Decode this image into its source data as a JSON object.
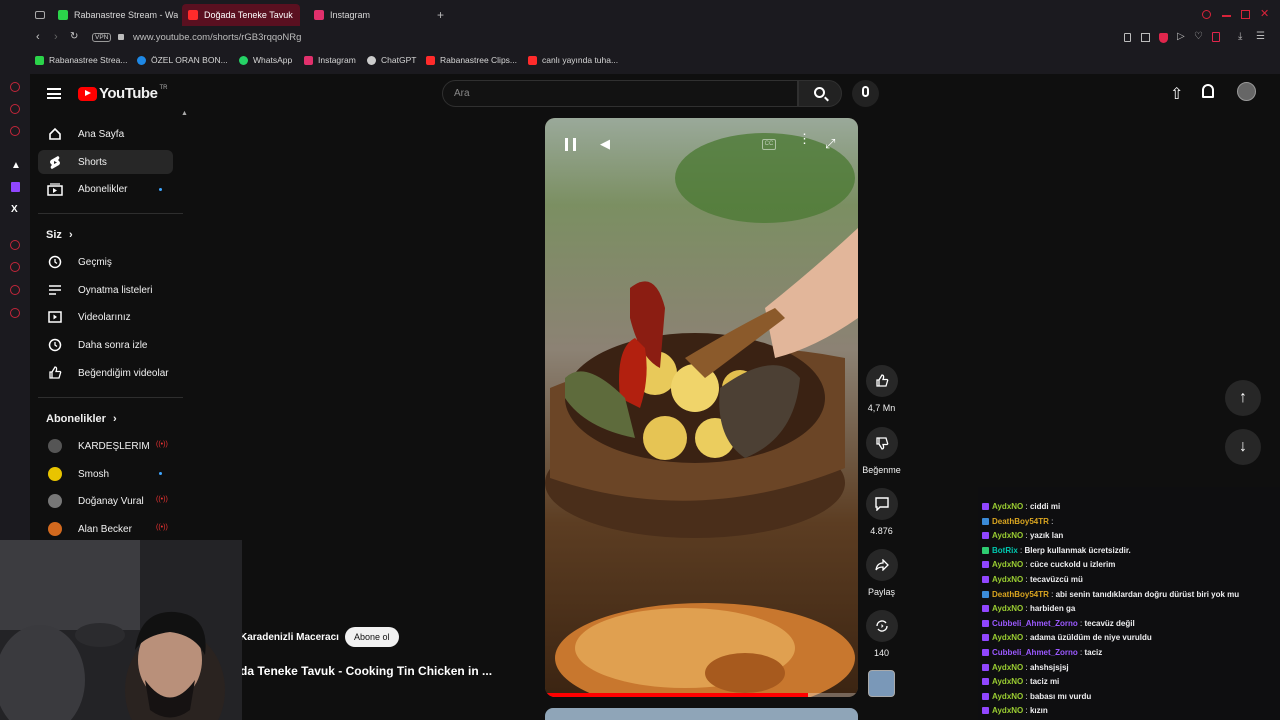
{
  "browser": {
    "tabs": [
      {
        "title": "Rabanastree Stream - Wa",
        "color": "#2bd44a"
      },
      {
        "title": "Doğada Teneke Tavuk",
        "color": "#ff2b2b"
      },
      {
        "title": "Instagram",
        "color": "#e1306c"
      }
    ],
    "new_tab": "+",
    "url": "www.youtube.com/shorts/rGB3rqqoNRg",
    "vpn": "VPN",
    "bookmarks": [
      {
        "label": "Rabanastree Strea...",
        "color": "#2bd44a"
      },
      {
        "label": "ÖZEL ORAN BON...",
        "color": "#1e88e5"
      },
      {
        "label": "WhatsApp",
        "color": "#25d366"
      },
      {
        "label": "Instagram",
        "color": "#e1306c"
      },
      {
        "label": "ChatGPT",
        "color": "#cccccc"
      },
      {
        "label": "Rabanastree Clips...",
        "color": "#ff2b2b"
      },
      {
        "label": "canlı yayında tuha...",
        "color": "#ff2b2b"
      }
    ]
  },
  "youtube": {
    "logo": "YouTube",
    "logo_region": "TR",
    "search_placeholder": "Ara",
    "nav": [
      {
        "label": "Ana Sayfa",
        "icon": "home-icon"
      },
      {
        "label": "Shorts",
        "icon": "shorts-icon"
      },
      {
        "label": "Abonelikler",
        "icon": "subscriptions-icon"
      }
    ],
    "you_heading": "Siz",
    "you_items": [
      {
        "label": "Geçmiş",
        "icon": "history-icon"
      },
      {
        "label": "Oynatma listeleri",
        "icon": "playlists-icon"
      },
      {
        "label": "Videolarınız",
        "icon": "your-videos-icon"
      },
      {
        "label": "Daha sonra izle",
        "icon": "watch-later-icon"
      },
      {
        "label": "Beğendiğim videolar",
        "icon": "liked-videos-icon"
      }
    ],
    "subs_heading": "Abonelikler",
    "subs": [
      {
        "label": "KARDEŞLERIM",
        "status": "live"
      },
      {
        "label": "Smosh",
        "status": "new"
      },
      {
        "label": "Doğanay Vural",
        "status": "live"
      },
      {
        "label": "Alan Becker",
        "status": "live"
      }
    ],
    "channel": "Karadenizli Maceracı",
    "subscribe": "Abone ol",
    "video_title": "da Teneke Tavuk - Cooking Tin Chicken in ...",
    "actions": {
      "likes": "4,7 Mn",
      "dislike": "Beğenme",
      "comments": "4.876",
      "share": "Paylaş",
      "remix": "140"
    },
    "progress": 0.84
  },
  "chat": [
    {
      "user": "AydxNO",
      "text": "ciddi mi",
      "color": "#9ACD32"
    },
    {
      "user": "DeathBoy54TR",
      "text": "",
      "color": "#DAA520"
    },
    {
      "user": "AydxNO",
      "text": "yazık lan",
      "color": "#9ACD32"
    },
    {
      "user": "BotRix",
      "text": "Blerp kullanmak ücretsizdir.",
      "color": "#00C8AF"
    },
    {
      "user": "AydxNO",
      "text": "cüce cuckold u izlerim",
      "color": "#9ACD32"
    },
    {
      "user": "AydxNO",
      "text": "tecavüzcü mü",
      "color": "#9ACD32"
    },
    {
      "user": "DeathBoy54TR",
      "text": "abi senin tanıdıklardan doğru dürüst biri yok mu",
      "color": "#DAA520"
    },
    {
      "user": "AydxNO",
      "text": "harbiden ga",
      "color": "#9ACD32"
    },
    {
      "user": "Cubbeli_Ahmet_Zorno",
      "text": "tecavüz değil",
      "color": "#9B59FF"
    },
    {
      "user": "AydxNO",
      "text": "adama üzüldüm de niye vuruldu",
      "color": "#9ACD32"
    },
    {
      "user": "Cubbeli_Ahmet_Zorno",
      "text": "taciz",
      "color": "#9B59FF"
    },
    {
      "user": "AydxNO",
      "text": "ahshsjsjsj",
      "color": "#9ACD32"
    },
    {
      "user": "AydxNO",
      "text": "taciz mi",
      "color": "#9ACD32"
    },
    {
      "user": "AydxNO",
      "text": "babası mı vurdu",
      "color": "#9ACD32"
    },
    {
      "user": "AydxNO",
      "text": "kızın",
      "color": "#9ACD32"
    }
  ]
}
